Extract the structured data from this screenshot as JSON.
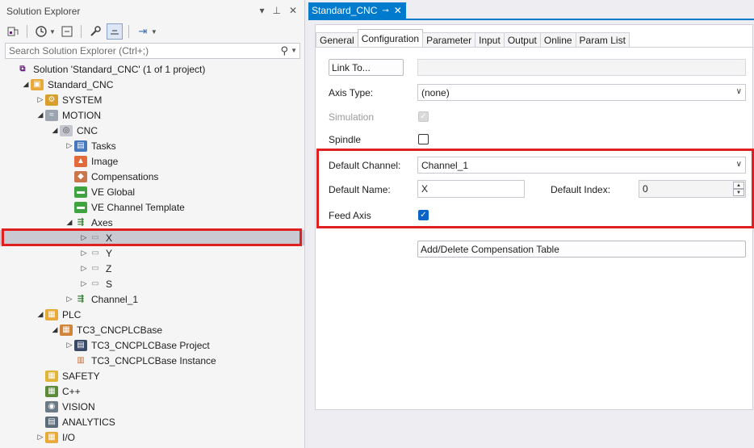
{
  "solution_explorer": {
    "title": "Solution Explorer",
    "title_buttons": [
      "▾",
      "⊥",
      "✕"
    ],
    "search_placeholder": "Search Solution Explorer (Ctrl+;)",
    "tree": [
      {
        "label": "Solution 'Standard_CNC' (1 of 1 project)",
        "icon": "solution-icon",
        "glyph": "⧉",
        "level": 0,
        "arrow": "",
        "name": "tree-item-solution"
      },
      {
        "label": "Standard_CNC",
        "icon": "project-icon",
        "glyph": "▣",
        "level": 1,
        "arrow": "◢",
        "name": "tree-item-standard-cnc"
      },
      {
        "label": "SYSTEM",
        "icon": "system-icon",
        "glyph": "⚙",
        "level": 2,
        "arrow": "▷",
        "name": "tree-item-system"
      },
      {
        "label": "MOTION",
        "icon": "motion-icon",
        "glyph": "≈",
        "level": 2,
        "arrow": "◢",
        "name": "tree-item-motion"
      },
      {
        "label": "CNC",
        "icon": "cnc-icon",
        "glyph": "◎",
        "level": 3,
        "arrow": "◢",
        "name": "tree-item-cnc"
      },
      {
        "label": "Tasks",
        "icon": "tasks-icon",
        "glyph": "▤",
        "level": 4,
        "arrow": "▷",
        "name": "tree-item-tasks"
      },
      {
        "label": "Image",
        "icon": "image-icon",
        "glyph": "▲",
        "level": 4,
        "arrow": "",
        "name": "tree-item-image"
      },
      {
        "label": "Compensations",
        "icon": "compensations-icon",
        "glyph": "◆",
        "level": 4,
        "arrow": "",
        "name": "tree-item-compensations"
      },
      {
        "label": "VE Global",
        "icon": "ve-global-icon",
        "glyph": "▬",
        "level": 4,
        "arrow": "",
        "name": "tree-item-ve-global"
      },
      {
        "label": "VE Channel Template",
        "icon": "ve-channel-icon",
        "glyph": "▬",
        "level": 4,
        "arrow": "",
        "name": "tree-item-ve-channel-template"
      },
      {
        "label": "Axes",
        "icon": "axes-icon",
        "glyph": "⇶",
        "level": 4,
        "arrow": "◢",
        "name": "tree-item-axes"
      },
      {
        "label": "X",
        "icon": "axis-icon",
        "glyph": "▭",
        "level": 5,
        "arrow": "▷",
        "name": "tree-item-axis-x",
        "selected": true
      },
      {
        "label": "Y",
        "icon": "axis-icon",
        "glyph": "▭",
        "level": 5,
        "arrow": "▷",
        "name": "tree-item-axis-y"
      },
      {
        "label": "Z",
        "icon": "axis-icon",
        "glyph": "▭",
        "level": 5,
        "arrow": "▷",
        "name": "tree-item-axis-z"
      },
      {
        "label": "S",
        "icon": "axis-icon",
        "glyph": "▭",
        "level": 5,
        "arrow": "▷",
        "name": "tree-item-axis-s"
      },
      {
        "label": "Channel_1",
        "icon": "channel-icon",
        "glyph": "⇶",
        "level": 4,
        "arrow": "▷",
        "name": "tree-item-channel-1"
      },
      {
        "label": "PLC",
        "icon": "plc-icon",
        "glyph": "▦",
        "level": 2,
        "arrow": "◢",
        "name": "tree-item-plc"
      },
      {
        "label": "TC3_CNCPLCBase",
        "icon": "plc-project-icon",
        "glyph": "▦",
        "level": 3,
        "arrow": "◢",
        "name": "tree-item-tc3-cncplcbase"
      },
      {
        "label": "TC3_CNCPLCBase Project",
        "icon": "plc-source-icon",
        "glyph": "▤",
        "level": 4,
        "arrow": "▷",
        "name": "tree-item-tc3-cncplcbase-project"
      },
      {
        "label": "TC3_CNCPLCBase Instance",
        "icon": "plc-instance-icon",
        "glyph": "▥",
        "level": 4,
        "arrow": "",
        "name": "tree-item-tc3-cncplcbase-instance"
      },
      {
        "label": "SAFETY",
        "icon": "safety-icon",
        "glyph": "▦",
        "level": 2,
        "arrow": "",
        "name": "tree-item-safety"
      },
      {
        "label": "C++",
        "icon": "cpp-icon",
        "glyph": "▦",
        "level": 2,
        "arrow": "",
        "name": "tree-item-cpp"
      },
      {
        "label": "VISION",
        "icon": "vision-icon",
        "glyph": "◉",
        "level": 2,
        "arrow": "",
        "name": "tree-item-vision"
      },
      {
        "label": "ANALYTICS",
        "icon": "analytics-icon",
        "glyph": "▤",
        "level": 2,
        "arrow": "",
        "name": "tree-item-analytics"
      },
      {
        "label": "I/O",
        "icon": "io-icon",
        "glyph": "▦",
        "level": 2,
        "arrow": "▷",
        "name": "tree-item-io"
      }
    ]
  },
  "document": {
    "tab_label": "Standard_CNC",
    "tab_pin": "⊸",
    "tab_close": "✕",
    "tabs": [
      "General",
      "Configuration",
      "Parameter",
      "Input",
      "Output",
      "Online",
      "Param List"
    ],
    "active_tab": "Configuration",
    "link_button": "Link To...",
    "axis_type_label": "Axis Type:",
    "axis_type_value": "(none)",
    "simulation_label": "Simulation",
    "spindle_label": "Spindle",
    "default_channel_label": "Default Channel:",
    "default_channel_value": "Channel_1",
    "default_name_label": "Default Name:",
    "default_name_value": "X",
    "default_index_label": "Default Index:",
    "default_index_value": "0",
    "feed_axis_label": "Feed Axis",
    "compensation_button": "Add/Delete Compensation Table",
    "checkbox_states": {
      "simulation": true,
      "spindle": false,
      "feed_axis": true
    }
  },
  "colors": {
    "accent": "#007acc",
    "highlight_border": "#e02020",
    "checkbox": "#0a64c8"
  }
}
